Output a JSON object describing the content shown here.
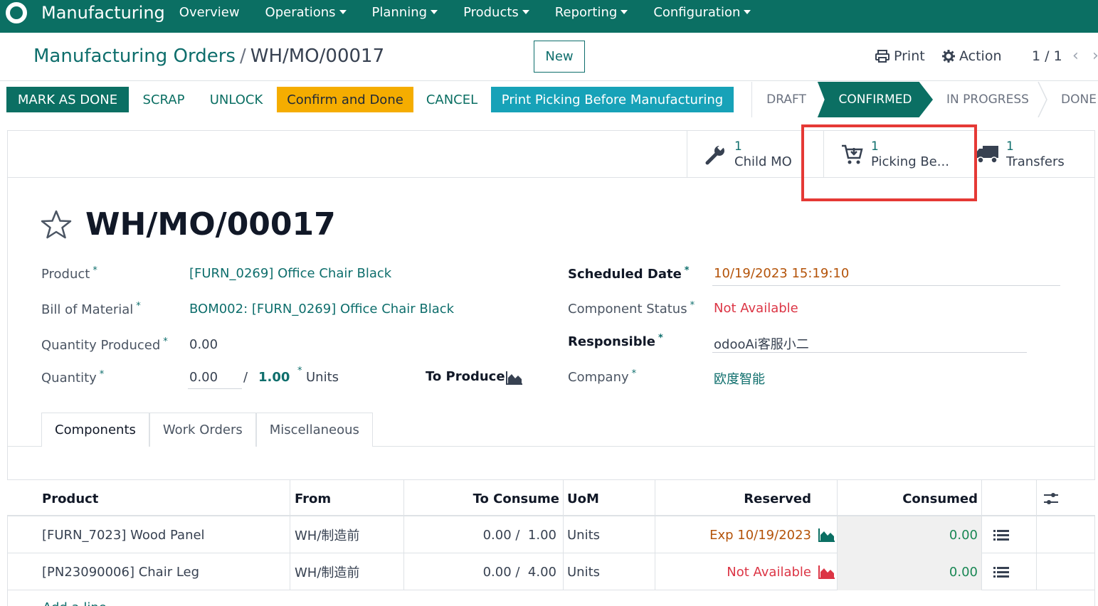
{
  "navbar": {
    "app_title": "Manufacturing",
    "items": [
      "Overview",
      "Operations",
      "Planning",
      "Products",
      "Reporting",
      "Configuration"
    ]
  },
  "breadcrumb": {
    "parent": "Manufacturing Orders",
    "separator": "/",
    "current": "WH/MO/00017"
  },
  "control": {
    "new_label": "New",
    "print_label": "Print",
    "action_label": "Action",
    "pager": "1 / 1"
  },
  "actions": {
    "mark_done": "MARK AS DONE",
    "scrap": "SCRAP",
    "unlock": "UNLOCK",
    "confirm_done": "Confirm and Done",
    "cancel": "CANCEL",
    "print_picking": "Print Picking Before Manufacturing"
  },
  "status": {
    "stages": [
      "DRAFT",
      "CONFIRMED",
      "IN PROGRESS",
      "DONE"
    ],
    "active": "CONFIRMED"
  },
  "smart_buttons": [
    {
      "count": "1",
      "label": "Child MO",
      "icon": "wrench-icon"
    },
    {
      "count": "1",
      "label": "Picking Be...",
      "icon": "cart-icon"
    },
    {
      "count": "1",
      "label": "Transfers",
      "icon": "truck-icon"
    }
  ],
  "record": {
    "title": "WH/MO/00017"
  },
  "fields": {
    "product_label": "Product",
    "product_value": "[FURN_0269] Office Chair Black",
    "bom_label": "Bill of Material",
    "bom_value": "BOM002: [FURN_0269] Office Chair Black",
    "qty_produced_label": "Quantity Produced",
    "qty_produced_value": "0.00",
    "quantity_label": "Quantity",
    "quantity_value": "0.00",
    "quantity_sep": "/",
    "quantity_target": "1.00",
    "quantity_unit": "Units",
    "to_produce_label": "To Produce",
    "scheduled_label": "Scheduled Date",
    "scheduled_value": "10/19/2023 15:19:10",
    "comp_status_label": "Component Status",
    "comp_status_value": "Not Available",
    "responsible_label": "Responsible",
    "responsible_value": "odooAi客服小二",
    "company_label": "Company",
    "company_value": "欧度智能"
  },
  "tabs": [
    "Components",
    "Work Orders",
    "Miscellaneous"
  ],
  "table": {
    "headers": [
      "Product",
      "From",
      "To Consume",
      "UoM",
      "Reserved",
      "Consumed"
    ],
    "rows": [
      {
        "product": "[FURN_7023] Wood Panel",
        "from": "WH/制造前",
        "to_consume": "0.00 /  1.00",
        "uom": "Units",
        "reserved": "Exp 10/19/2023",
        "reserved_color": "#b45309",
        "consumed": "0.00"
      },
      {
        "product": "[PN23090006] Chair Leg",
        "from": "WH/制造前",
        "to_consume": "0.00 /  4.00",
        "uom": "Units",
        "reserved": "Not Available",
        "reserved_color": "#dc3545",
        "consumed": "0.00"
      }
    ],
    "add_line": "Add a line"
  },
  "colors": {
    "brand": "#0b6f63",
    "warning": "#f5ad00",
    "info": "#17a2b8",
    "danger": "#dc3545",
    "highlight": "#e53935"
  }
}
